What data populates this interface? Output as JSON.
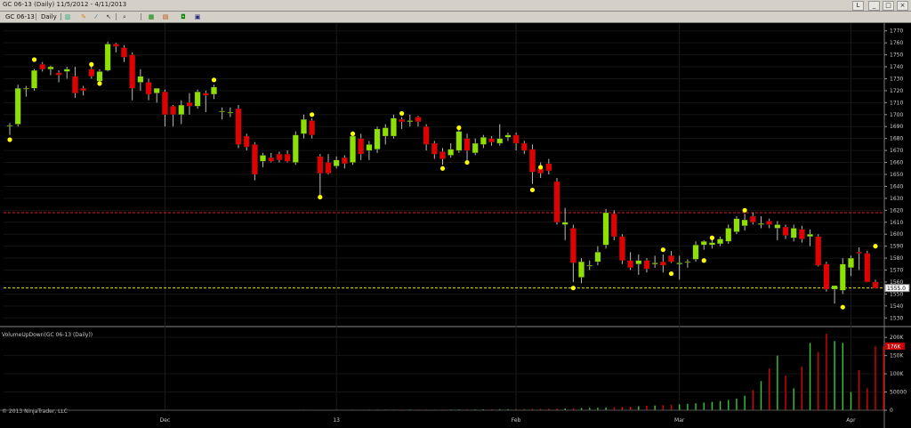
{
  "window": {
    "title": "GC 06-13 (Daily)  11/5/2012 - 4/11/2013",
    "buttons": {
      "layout": "L",
      "minimize": "_",
      "maximize": "□",
      "close": "×"
    }
  },
  "toolbar": {
    "instrument": "GC 06-13",
    "period": "Daily",
    "icons": [
      "bar-style-icon",
      "pencil-icon",
      "drawing-tools-icon",
      "pointer-icon",
      "zoom-icon",
      "properties-icon",
      "indicators-icon",
      "strategies-icon",
      "data-box-icon"
    ]
  },
  "footer": {
    "copyright": "© 2013 NinjaTrader, LLC"
  },
  "colors": {
    "background": "#000000",
    "up": "#8ee000",
    "down": "#e00000",
    "resistance": "#e02020",
    "support": "#e8e800",
    "marker": "#ffff00",
    "axis_text": "#cccccc"
  },
  "chart_data": [
    {
      "type": "candlestick",
      "title": "GC 06-13 (Daily)",
      "ylim": [
        1525,
        1775
      ],
      "yticks": [
        1530,
        1540,
        1550,
        1560,
        1570,
        1580,
        1590,
        1600,
        1610,
        1620,
        1630,
        1640,
        1650,
        1660,
        1670,
        1680,
        1690,
        1700,
        1710,
        1720,
        1730,
        1740,
        1750,
        1760,
        1770
      ],
      "xticks": [
        {
          "label": "Dec",
          "index": 19
        },
        {
          "label": "13",
          "index": 40
        },
        {
          "label": "Feb",
          "index": 62
        },
        {
          "label": "Mar",
          "index": 82
        },
        {
          "label": "Apr",
          "index": 103
        }
      ],
      "current_price_label": "1555.0",
      "hlines": [
        {
          "value": 1618,
          "style": "dashed",
          "color": "#e02020"
        },
        {
          "value": 1555,
          "style": "dashed",
          "color": "#e8e800"
        }
      ],
      "candles": [
        {
          "o": 1691,
          "h": 1693,
          "l": 1683,
          "c": 1691
        },
        {
          "o": 1692,
          "h": 1725,
          "l": 1690,
          "c": 1722
        },
        {
          "o": 1722,
          "h": 1724,
          "l": 1715,
          "c": 1722
        },
        {
          "o": 1722,
          "h": 1738,
          "l": 1720,
          "c": 1737
        },
        {
          "o": 1742,
          "h": 1744,
          "l": 1736,
          "c": 1738
        },
        {
          "o": 1738,
          "h": 1741,
          "l": 1733,
          "c": 1740
        },
        {
          "o": 1735,
          "h": 1737,
          "l": 1727,
          "c": 1733
        },
        {
          "o": 1736,
          "h": 1740,
          "l": 1730,
          "c": 1738
        },
        {
          "o": 1732,
          "h": 1740,
          "l": 1714,
          "c": 1718
        },
        {
          "o": 1722,
          "h": 1724,
          "l": 1716,
          "c": 1720
        },
        {
          "o": 1738,
          "h": 1742,
          "l": 1730,
          "c": 1732
        },
        {
          "o": 1728,
          "h": 1738,
          "l": 1726,
          "c": 1736
        },
        {
          "o": 1737,
          "h": 1761,
          "l": 1736,
          "c": 1759
        },
        {
          "o": 1759,
          "h": 1760,
          "l": 1752,
          "c": 1757
        },
        {
          "o": 1756,
          "h": 1758,
          "l": 1744,
          "c": 1748
        },
        {
          "o": 1750,
          "h": 1752,
          "l": 1712,
          "c": 1722
        },
        {
          "o": 1727,
          "h": 1738,
          "l": 1720,
          "c": 1732
        },
        {
          "o": 1727,
          "h": 1730,
          "l": 1712,
          "c": 1717
        },
        {
          "o": 1718,
          "h": 1722,
          "l": 1710,
          "c": 1722
        },
        {
          "o": 1719,
          "h": 1721,
          "l": 1690,
          "c": 1700
        },
        {
          "o": 1707,
          "h": 1708,
          "l": 1690,
          "c": 1700
        },
        {
          "o": 1700,
          "h": 1712,
          "l": 1692,
          "c": 1708
        },
        {
          "o": 1710,
          "h": 1718,
          "l": 1700,
          "c": 1707
        },
        {
          "o": 1707,
          "h": 1721,
          "l": 1705,
          "c": 1719
        },
        {
          "o": 1718,
          "h": 1720,
          "l": 1702,
          "c": 1716
        },
        {
          "o": 1717,
          "h": 1725,
          "l": 1713,
          "c": 1723
        },
        {
          "o": 1703,
          "h": 1706,
          "l": 1696,
          "c": 1703
        },
        {
          "o": 1702,
          "h": 1706,
          "l": 1698,
          "c": 1702
        },
        {
          "o": 1705,
          "h": 1708,
          "l": 1672,
          "c": 1675
        },
        {
          "o": 1682,
          "h": 1684,
          "l": 1670,
          "c": 1673
        },
        {
          "o": 1675,
          "h": 1677,
          "l": 1645,
          "c": 1650
        },
        {
          "o": 1661,
          "h": 1668,
          "l": 1656,
          "c": 1666
        },
        {
          "o": 1664,
          "h": 1668,
          "l": 1660,
          "c": 1661
        },
        {
          "o": 1667,
          "h": 1669,
          "l": 1660,
          "c": 1662
        },
        {
          "o": 1667,
          "h": 1670,
          "l": 1660,
          "c": 1661
        },
        {
          "o": 1660,
          "h": 1686,
          "l": 1658,
          "c": 1683
        },
        {
          "o": 1684,
          "h": 1700,
          "l": 1680,
          "c": 1696
        },
        {
          "o": 1695,
          "h": 1697,
          "l": 1680,
          "c": 1683
        },
        {
          "o": 1665,
          "h": 1667,
          "l": 1632,
          "c": 1651
        },
        {
          "o": 1660,
          "h": 1667,
          "l": 1650,
          "c": 1651
        },
        {
          "o": 1657,
          "h": 1665,
          "l": 1655,
          "c": 1662
        },
        {
          "o": 1664,
          "h": 1666,
          "l": 1655,
          "c": 1659
        },
        {
          "o": 1660,
          "h": 1686,
          "l": 1658,
          "c": 1682
        },
        {
          "o": 1680,
          "h": 1684,
          "l": 1662,
          "c": 1667
        },
        {
          "o": 1670,
          "h": 1678,
          "l": 1662,
          "c": 1675
        },
        {
          "o": 1671,
          "h": 1690,
          "l": 1668,
          "c": 1688
        },
        {
          "o": 1682,
          "h": 1692,
          "l": 1675,
          "c": 1689
        },
        {
          "o": 1682,
          "h": 1700,
          "l": 1680,
          "c": 1697
        },
        {
          "o": 1696,
          "h": 1698,
          "l": 1688,
          "c": 1694
        },
        {
          "o": 1694,
          "h": 1700,
          "l": 1690,
          "c": 1695
        },
        {
          "o": 1698,
          "h": 1699,
          "l": 1690,
          "c": 1694
        },
        {
          "o": 1690,
          "h": 1692,
          "l": 1670,
          "c": 1675
        },
        {
          "o": 1676,
          "h": 1678,
          "l": 1663,
          "c": 1667
        },
        {
          "o": 1669,
          "h": 1672,
          "l": 1658,
          "c": 1663
        },
        {
          "o": 1666,
          "h": 1676,
          "l": 1664,
          "c": 1671
        },
        {
          "o": 1670,
          "h": 1689,
          "l": 1668,
          "c": 1686
        },
        {
          "o": 1680,
          "h": 1684,
          "l": 1662,
          "c": 1670
        },
        {
          "o": 1668,
          "h": 1680,
          "l": 1666,
          "c": 1676
        },
        {
          "o": 1675,
          "h": 1683,
          "l": 1672,
          "c": 1681
        },
        {
          "o": 1680,
          "h": 1682,
          "l": 1674,
          "c": 1677
        },
        {
          "o": 1676,
          "h": 1692,
          "l": 1674,
          "c": 1680
        },
        {
          "o": 1681,
          "h": 1685,
          "l": 1678,
          "c": 1683
        },
        {
          "o": 1683,
          "h": 1685,
          "l": 1670,
          "c": 1676
        },
        {
          "o": 1676,
          "h": 1678,
          "l": 1667,
          "c": 1670
        },
        {
          "o": 1671,
          "h": 1675,
          "l": 1642,
          "c": 1652
        },
        {
          "o": 1655,
          "h": 1660,
          "l": 1647,
          "c": 1651
        },
        {
          "o": 1659,
          "h": 1663,
          "l": 1650,
          "c": 1653
        },
        {
          "o": 1644,
          "h": 1647,
          "l": 1608,
          "c": 1610
        },
        {
          "o": 1608,
          "h": 1622,
          "l": 1595,
          "c": 1610
        },
        {
          "o": 1605,
          "h": 1608,
          "l": 1560,
          "c": 1576
        },
        {
          "o": 1564,
          "h": 1580,
          "l": 1559,
          "c": 1577
        },
        {
          "o": 1574,
          "h": 1578,
          "l": 1570,
          "c": 1574
        },
        {
          "o": 1577,
          "h": 1590,
          "l": 1574,
          "c": 1585
        },
        {
          "o": 1591,
          "h": 1621,
          "l": 1588,
          "c": 1618
        },
        {
          "o": 1617,
          "h": 1620,
          "l": 1595,
          "c": 1598
        },
        {
          "o": 1598,
          "h": 1600,
          "l": 1575,
          "c": 1578
        },
        {
          "o": 1578,
          "h": 1585,
          "l": 1570,
          "c": 1572
        },
        {
          "o": 1575,
          "h": 1583,
          "l": 1566,
          "c": 1578
        },
        {
          "o": 1578,
          "h": 1580,
          "l": 1568,
          "c": 1571
        },
        {
          "o": 1575,
          "h": 1582,
          "l": 1572,
          "c": 1576
        },
        {
          "o": 1577,
          "h": 1583,
          "l": 1568,
          "c": 1574
        },
        {
          "o": 1582,
          "h": 1586,
          "l": 1576,
          "c": 1577
        },
        {
          "o": 1575,
          "h": 1582,
          "l": 1562,
          "c": 1576
        },
        {
          "o": 1577,
          "h": 1579,
          "l": 1572,
          "c": 1577
        },
        {
          "o": 1579,
          "h": 1594,
          "l": 1577,
          "c": 1591
        },
        {
          "o": 1591,
          "h": 1595,
          "l": 1587,
          "c": 1594
        },
        {
          "o": 1591,
          "h": 1596,
          "l": 1588,
          "c": 1593
        },
        {
          "o": 1592,
          "h": 1598,
          "l": 1590,
          "c": 1596
        },
        {
          "o": 1594,
          "h": 1608,
          "l": 1592,
          "c": 1605
        },
        {
          "o": 1602,
          "h": 1615,
          "l": 1600,
          "c": 1613
        },
        {
          "o": 1607,
          "h": 1617,
          "l": 1603,
          "c": 1612
        },
        {
          "o": 1615,
          "h": 1618,
          "l": 1608,
          "c": 1610
        },
        {
          "o": 1608,
          "h": 1615,
          "l": 1605,
          "c": 1609
        },
        {
          "o": 1611,
          "h": 1613,
          "l": 1605,
          "c": 1608
        },
        {
          "o": 1605,
          "h": 1611,
          "l": 1595,
          "c": 1608
        },
        {
          "o": 1606,
          "h": 1608,
          "l": 1596,
          "c": 1599
        },
        {
          "o": 1597,
          "h": 1608,
          "l": 1594,
          "c": 1605
        },
        {
          "o": 1604,
          "h": 1607,
          "l": 1593,
          "c": 1596
        },
        {
          "o": 1598,
          "h": 1604,
          "l": 1590,
          "c": 1600
        },
        {
          "o": 1598,
          "h": 1600,
          "l": 1573,
          "c": 1574
        },
        {
          "o": 1575,
          "h": 1577,
          "l": 1552,
          "c": 1554
        },
        {
          "o": 1554,
          "h": 1556,
          "l": 1542,
          "c": 1557
        },
        {
          "o": 1553,
          "h": 1580,
          "l": 1550,
          "c": 1575
        },
        {
          "o": 1572,
          "h": 1582,
          "l": 1565,
          "c": 1580
        },
        {
          "o": 1585,
          "h": 1589,
          "l": 1570,
          "c": 1584
        },
        {
          "o": 1584,
          "h": 1586,
          "l": 1560,
          "c": 1560
        },
        {
          "o": 1560,
          "h": 1562,
          "l": 1555,
          "c": 1555
        }
      ],
      "markers": [
        {
          "index": 0,
          "value": 1679
        },
        {
          "index": 3,
          "value": 1746
        },
        {
          "index": 10,
          "value": 1742
        },
        {
          "index": 11,
          "value": 1726
        },
        {
          "index": 25,
          "value": 1729
        },
        {
          "index": 38,
          "value": 1631
        },
        {
          "index": 37,
          "value": 1700
        },
        {
          "index": 42,
          "value": 1684
        },
        {
          "index": 48,
          "value": 1701
        },
        {
          "index": 53,
          "value": 1655
        },
        {
          "index": 55,
          "value": 1689
        },
        {
          "index": 56,
          "value": 1660
        },
        {
          "index": 64,
          "value": 1637
        },
        {
          "index": 65,
          "value": 1656
        },
        {
          "index": 69,
          "value": 1555
        },
        {
          "index": 80,
          "value": 1587
        },
        {
          "index": 81,
          "value": 1567
        },
        {
          "index": 85,
          "value": 1578
        },
        {
          "index": 86,
          "value": 1597
        },
        {
          "index": 90,
          "value": 1620
        },
        {
          "index": 102,
          "value": 1539
        },
        {
          "index": 106,
          "value": 1590
        }
      ]
    },
    {
      "type": "bar",
      "title": "VolumeUpDown(GC 06-13 (Daily))",
      "ylim": [
        0,
        220000
      ],
      "yticks": [
        {
          "label": "0",
          "value": 0
        },
        {
          "label": "50000",
          "value": 50000
        },
        {
          "label": "100K",
          "value": 100000
        },
        {
          "label": "150K",
          "value": 150000
        },
        {
          "label": "200K",
          "value": 200000
        }
      ],
      "current_value_label": "176K",
      "volumes": [
        1000,
        1000,
        1000,
        1000,
        1000,
        1000,
        1000,
        1000,
        1000,
        1000,
        1000,
        1000,
        1000,
        1000,
        1000,
        1000,
        1000,
        1000,
        1000,
        1000,
        1200,
        1200,
        1200,
        1200,
        1200,
        1200,
        1200,
        1200,
        1300,
        1300,
        1300,
        1300,
        1300,
        1300,
        1300,
        1300,
        1500,
        1500,
        1500,
        1500,
        1500,
        1600,
        1600,
        1600,
        1600,
        1700,
        1700,
        1700,
        1800,
        1800,
        1800,
        1900,
        1900,
        2000,
        2000,
        2100,
        2100,
        2200,
        2400,
        2500,
        2700,
        2900,
        3000,
        3300,
        3600,
        3900,
        4200,
        4500,
        5000,
        5500,
        6000,
        6500,
        7000,
        7500,
        8000,
        9000,
        10000,
        11000,
        12000,
        13000,
        14000,
        15000,
        16000,
        17500,
        19000,
        21000,
        23000,
        25000,
        28000,
        32000,
        40000,
        55000,
        80000,
        115000,
        150000,
        95000,
        60000,
        120000,
        185000,
        160000,
        210000,
        190000,
        185000,
        50000,
        110000,
        60000,
        176000,
        176000
      ]
    }
  ]
}
